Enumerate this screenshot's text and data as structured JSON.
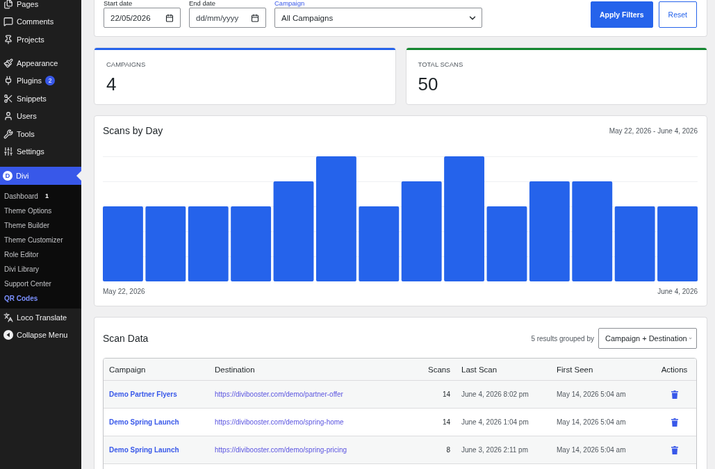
{
  "sidebar": {
    "groups": [
      {
        "items": [
          {
            "label": "Pages",
            "selected": false
          },
          {
            "label": "Comments",
            "selected": false
          },
          {
            "label": "Projects",
            "selected": false
          }
        ]
      },
      {
        "items": [
          {
            "label": "Appearance",
            "selected": false
          },
          {
            "label": "Plugins",
            "badge": "2",
            "selected": false
          },
          {
            "label": "Snippets",
            "selected": false
          },
          {
            "label": "Users",
            "selected": false
          },
          {
            "label": "Tools",
            "selected": false
          },
          {
            "label": "Settings",
            "selected": false
          }
        ]
      },
      {
        "items": [
          {
            "label": "Divi",
            "logo_letter": "D",
            "selected": true,
            "children": [
              {
                "label": "Dashboard",
                "badge": "1",
                "selected": false
              },
              {
                "label": "Theme Options",
                "selected": false
              },
              {
                "label": "Theme Builder",
                "selected": false
              },
              {
                "label": "Theme Customizer",
                "selected": false
              },
              {
                "label": "Role Editor",
                "selected": false
              },
              {
                "label": "Divi Library",
                "selected": false
              },
              {
                "label": "Support Center",
                "selected": false
              },
              {
                "label": "QR Codes",
                "selected": true
              }
            ]
          },
          {
            "label": "Loco Translate",
            "selected": false
          }
        ]
      }
    ],
    "collapse_label": "Collapse Menu"
  },
  "filters": {
    "fields": [
      {
        "kind": "date",
        "label": "Start date",
        "value": "22/05/2026"
      },
      {
        "kind": "date",
        "label": "End date",
        "placeholder": "dd/mm/yyyy"
      },
      {
        "kind": "select",
        "label": "Campaign",
        "value": "All Campaigns"
      }
    ],
    "buttons": [
      {
        "label": "Apply Filters",
        "kind": "primary"
      },
      {
        "label": "Reset",
        "kind": "secondary"
      }
    ]
  },
  "stats": [
    {
      "label": "CAMPAIGNS",
      "value": "4",
      "color": "#2563eb"
    },
    {
      "label": "TOTAL SCANS",
      "value": "50",
      "color": "#13862f"
    }
  ],
  "chart": {
    "title": "Scans by Day",
    "range": "May 22, 2026 - June 4, 2026",
    "start_label": "May 22, 2026",
    "end_label": "June 4, 2026"
  },
  "scan_data": {
    "title": "Scan Data",
    "results_label": "5 results grouped by",
    "group_by": "Campaign + Destination",
    "table": {
      "columns": [
        "Campaign",
        "Destination",
        "Scans",
        "Last Scan",
        "First Seen",
        "Actions"
      ],
      "rows": [
        {
          "campaign": "Demo Partner Flyers",
          "destination": "https://divibooster.com/demo/partner-offer",
          "scans": "14",
          "last_scan": "June 4, 2026 8:02 pm",
          "first_seen": "May 14, 2026 5:04 am"
        },
        {
          "campaign": "Demo Spring Launch",
          "destination": "https://divibooster.com/demo/spring-home",
          "scans": "14",
          "last_scan": "June 4, 2026 1:04 pm",
          "first_seen": "May 14, 2026 5:04 am"
        },
        {
          "campaign": "Demo Spring Launch",
          "destination": "https://divibooster.com/demo/spring-pricing",
          "scans": "8",
          "last_scan": "June 3, 2026 2:11 pm",
          "first_seen": "May 14, 2026 5:04 am"
        }
      ]
    }
  }
}
